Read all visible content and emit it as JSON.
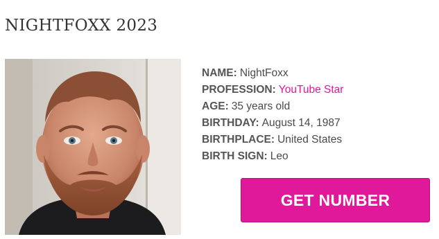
{
  "page": {
    "title": "NIGHTFOXX 2023"
  },
  "photo": {
    "alt": "NightFoxx"
  },
  "profile": {
    "rows": [
      {
        "label": "NAME:",
        "value": "NightFoxx"
      },
      {
        "label": "PROFESSION:",
        "value": "YouTube Star"
      },
      {
        "label": "AGE:",
        "value": "35 years old"
      },
      {
        "label": "BIRTHDAY:",
        "value": "August 14, 1987"
      },
      {
        "label": "BIRTHPLACE:",
        "value": "United States"
      },
      {
        "label": "BIRTH SIGN:",
        "value": "Leo"
      }
    ]
  },
  "cta": {
    "label": "GET NUMBER"
  },
  "colors": {
    "accent": "#e0189a",
    "text": "#4a4a4a",
    "title": "#333333"
  }
}
